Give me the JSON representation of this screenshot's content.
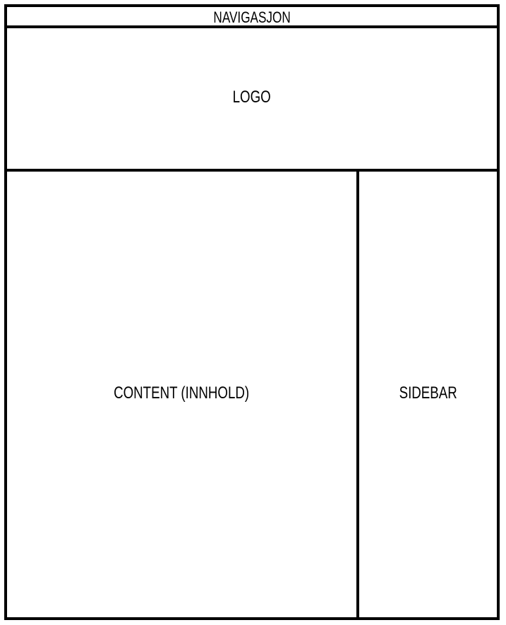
{
  "layout": {
    "navigation_label": "NAVIGASJON",
    "logo_label": "LOGO",
    "content_label": "CONTENT (INNHOLD)",
    "sidebar_label": "SIDEBAR"
  },
  "colors": {
    "background": "#ffffff",
    "lines": "#000000",
    "text": "#000000"
  }
}
